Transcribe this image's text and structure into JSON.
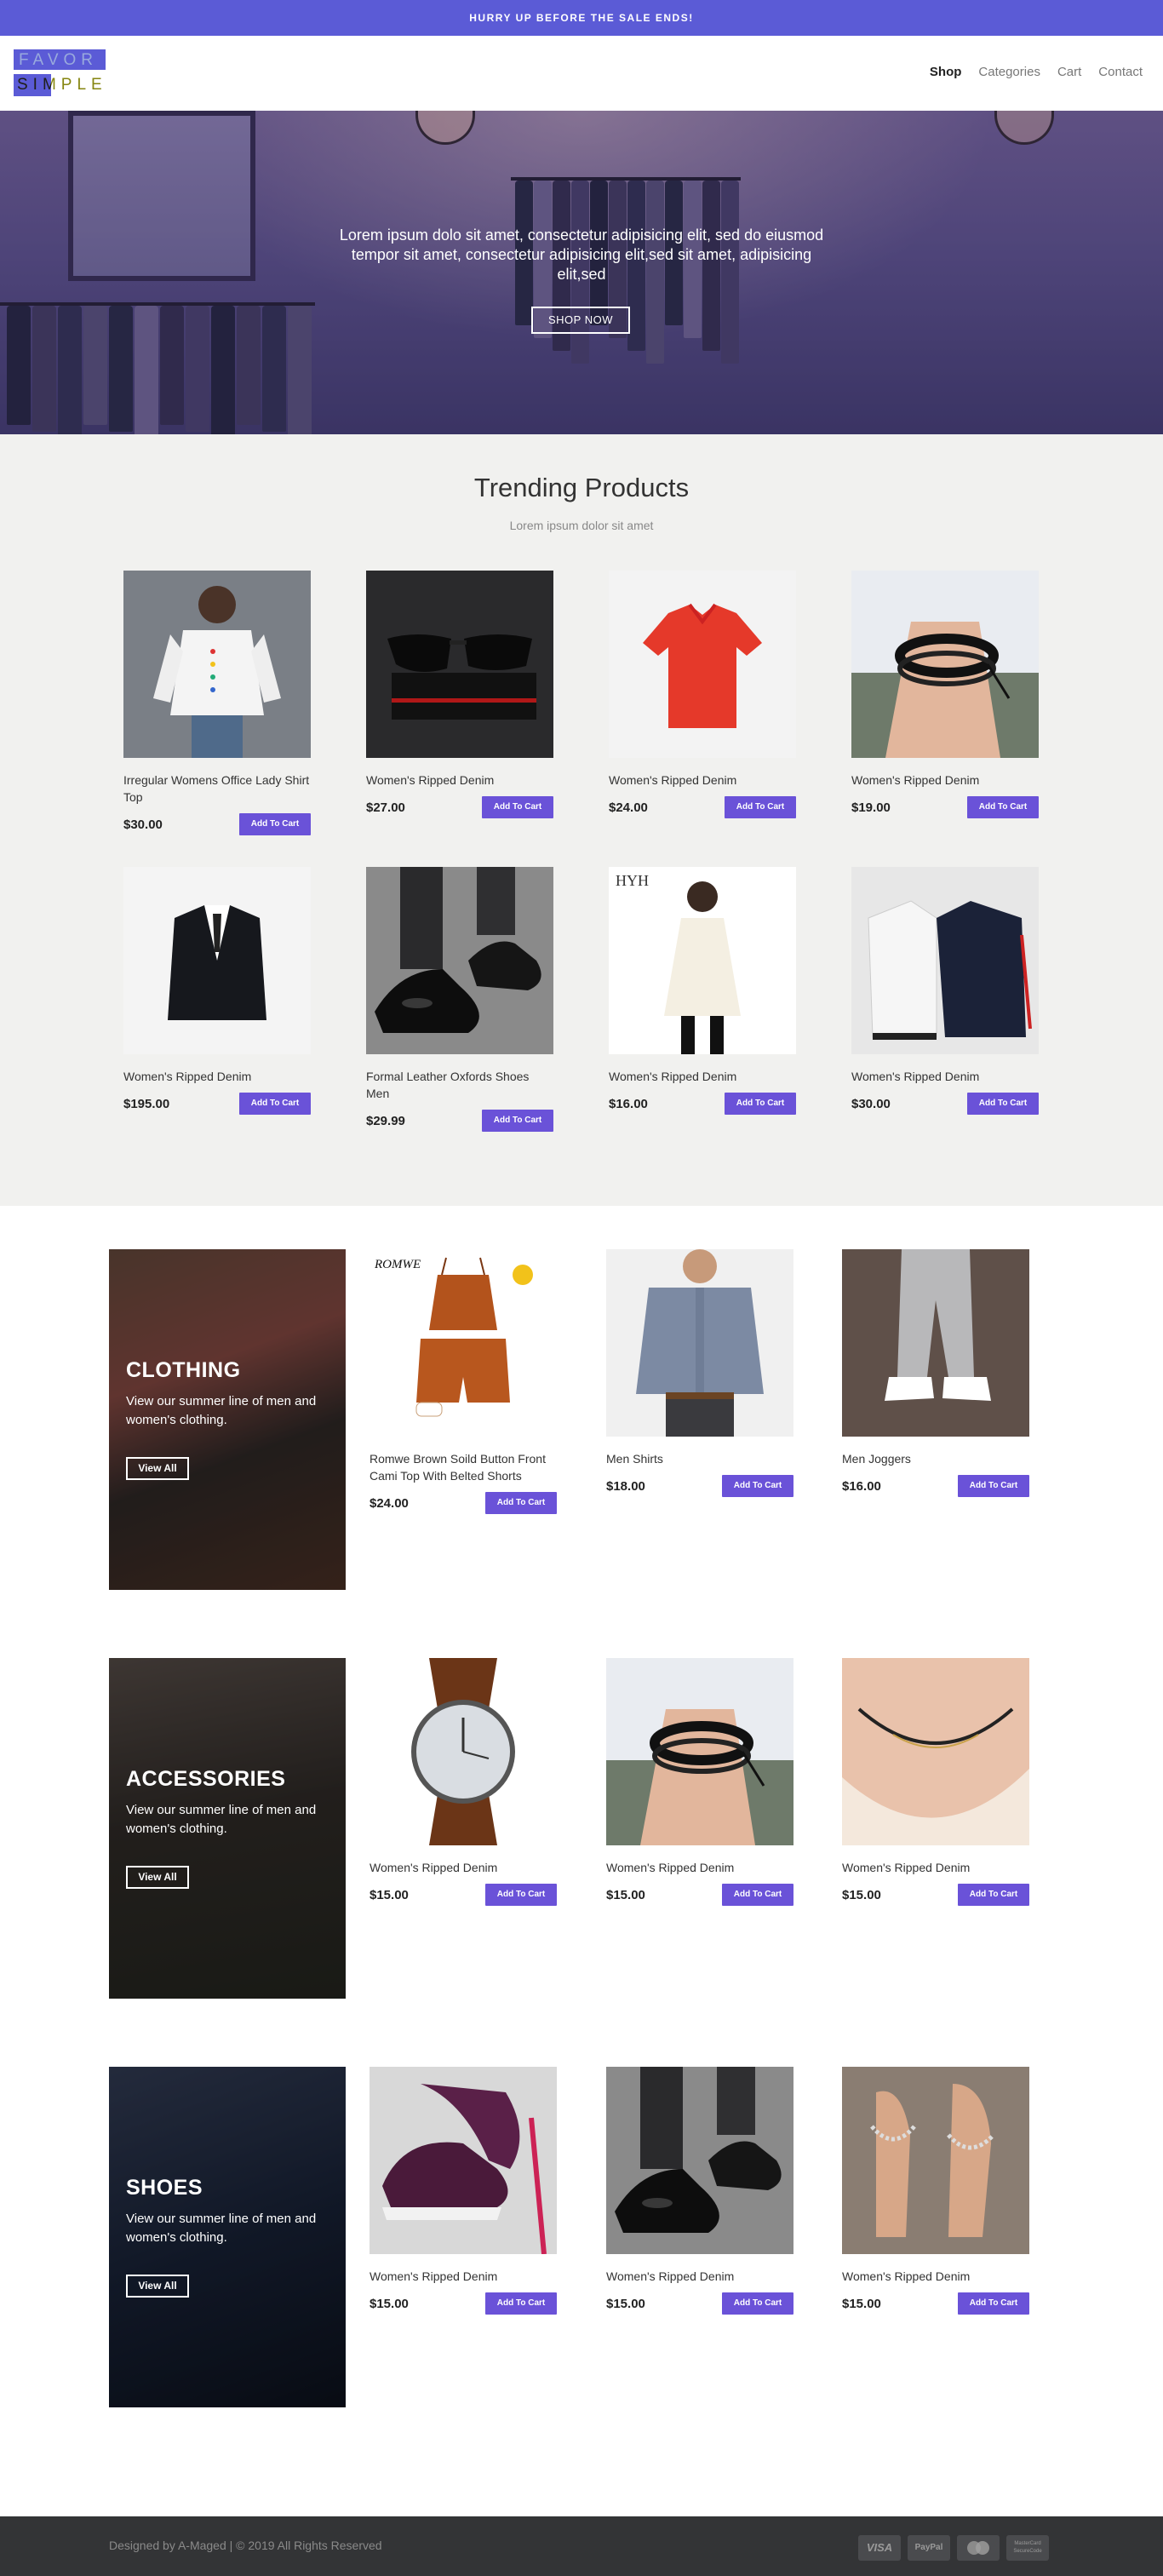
{
  "topbar": {
    "text": "HURRY UP BEFORE THE SALE ENDS!"
  },
  "header": {
    "logo_line1": "FAVOR",
    "logo_line2": "SIMPLE",
    "nav": [
      "Shop",
      "Categories",
      "Cart",
      "Contact"
    ]
  },
  "hero": {
    "text": "Lorem ipsum dolo sit amet, consectetur adipisicing elit, sed do eiusmod tempor sit amet, consectetur adipisicing elit,sed sit amet, adipisicing elit,sed",
    "button": "SHOP NOW"
  },
  "trending": {
    "title": "Trending Products",
    "subtitle": "Lorem ipsum dolor sit amet",
    "add_to_cart": "Add To Cart",
    "products": [
      {
        "name": "Irregular Womens Office Lady Shirt Top",
        "price": "$30.00",
        "icon": "white-shirt-icon"
      },
      {
        "name": "Women's Ripped Denim",
        "price": "$27.00",
        "icon": "sunglasses-icon"
      },
      {
        "name": "Women's Ripped Denim",
        "price": "$24.00",
        "icon": "polo-shirt-icon"
      },
      {
        "name": "Women's Ripped Denim",
        "price": "$19.00",
        "icon": "bracelet-icon"
      },
      {
        "name": "Women's Ripped Denim",
        "price": "$195.00",
        "icon": "suit-icon"
      },
      {
        "name": "Formal Leather Oxfords Shoes Men",
        "price": "$29.99",
        "icon": "oxford-shoe-icon"
      },
      {
        "name": "Women's Ripped Denim",
        "price": "$16.00",
        "icon": "dress-icon"
      },
      {
        "name": "Women's Ripped Denim",
        "price": "$30.00",
        "icon": "jacket-icon"
      }
    ]
  },
  "categories": [
    {
      "title": "CLOTHING",
      "description": "View our summer line of men and women's clothing.",
      "button": "View All",
      "products": [
        {
          "name": "Romwe Brown Soild Button Front Cami Top With Belted Shorts",
          "price": "$24.00",
          "icon": "cami-set-icon"
        },
        {
          "name": "Men Shirts",
          "price": "$18.00",
          "icon": "men-shirt-icon"
        },
        {
          "name": "Men Joggers",
          "price": "$16.00",
          "icon": "joggers-icon"
        }
      ]
    },
    {
      "title": "ACCESSORIES",
      "description": "View our summer line of men and women's clothing.",
      "button": "View All",
      "products": [
        {
          "name": "Women's Ripped Denim",
          "price": "$15.00",
          "icon": "watch-icon"
        },
        {
          "name": "Women's Ripped Denim",
          "price": "$15.00",
          "icon": "bracelet-icon"
        },
        {
          "name": "Women's Ripped Denim",
          "price": "$15.00",
          "icon": "necklace-icon"
        }
      ]
    },
    {
      "title": "SHOES",
      "description": "View our summer line of men and women's clothing.",
      "button": "View All",
      "products": [
        {
          "name": "Women's Ripped Denim",
          "price": "$15.00",
          "icon": "sneaker-icon"
        },
        {
          "name": "Women's Ripped Denim",
          "price": "$15.00",
          "icon": "oxford-shoe-icon"
        },
        {
          "name": "Women's Ripped Denim",
          "price": "$15.00",
          "icon": "sandal-icon"
        }
      ]
    }
  ],
  "footer": {
    "copyright": "Designed by A-Maged | © 2019 All Rights Reserved",
    "payments": [
      "VISA",
      "PayPal",
      "MasterCard",
      "MasterCard SecureCode"
    ]
  },
  "colors": {
    "accent": "#5b5bd6",
    "button": "#6a52d8",
    "footer": "#333436",
    "section_bg": "#f1f1ef"
  }
}
